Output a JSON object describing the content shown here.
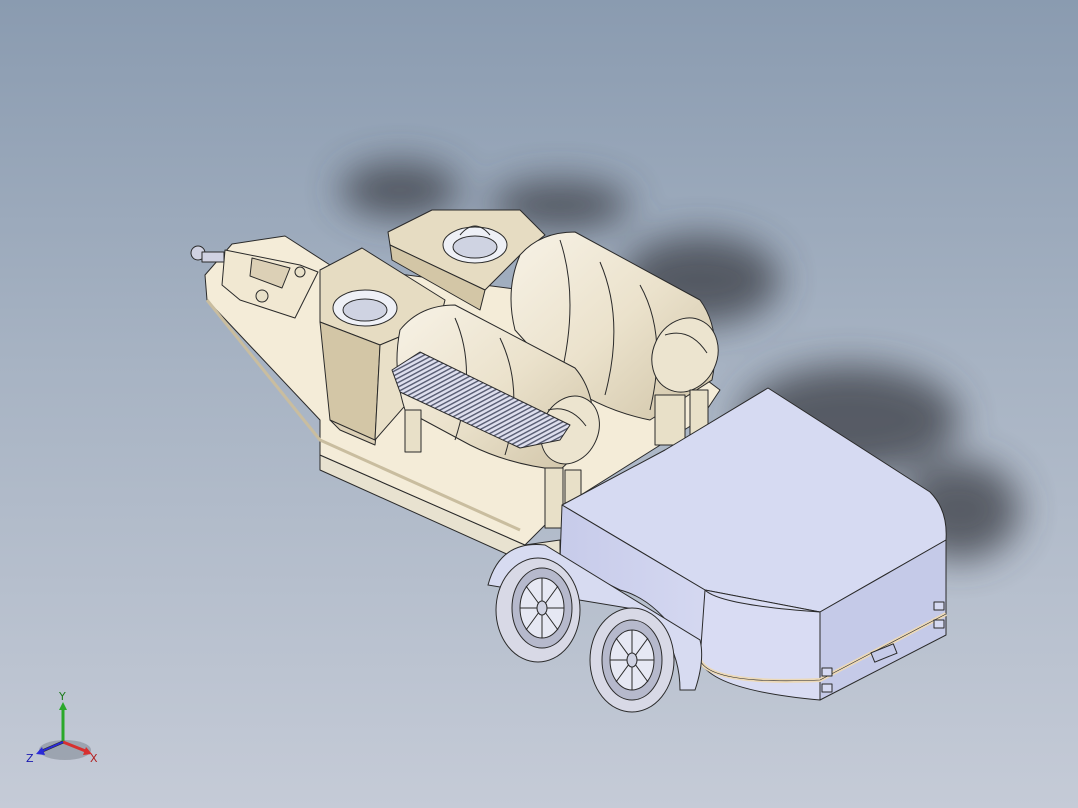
{
  "viewport": {
    "background_top": "#8a9bb0",
    "background_bottom": "#c5cbd7"
  },
  "model": {
    "colors": {
      "cream": "#f4ecd8",
      "cream_dark": "#dcd0b6",
      "cream_shadow": "#c9bd9f",
      "body": "#d6daf2",
      "body_dark": "#b8bde0",
      "body_light": "#e6e8f8",
      "edge": "#2a2a2a",
      "shadow": "#3b3d44",
      "tire": "#d8d9e6",
      "rim": "#b6b9cc"
    }
  },
  "triad": {
    "y_label": "Y",
    "x_label": "X",
    "z_label": "Z",
    "y_color": "#2aa82a",
    "x_color": "#d83030",
    "z_color": "#2a2ad8"
  }
}
